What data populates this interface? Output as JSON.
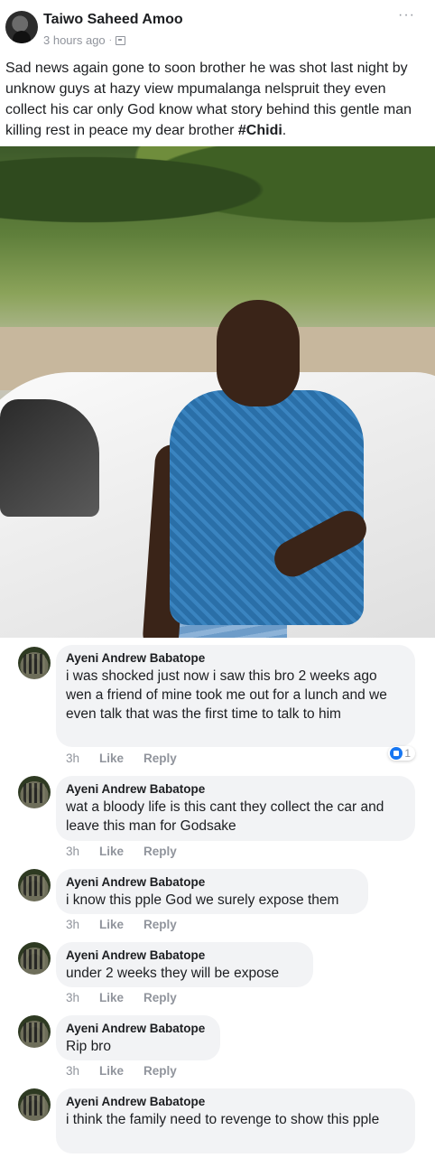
{
  "post": {
    "author": "Taiwo Saheed Amoo",
    "timestamp": "3 hours ago",
    "separator": "·",
    "privacy_icon": "globe-icon",
    "more_icon": "···",
    "text_main": "Sad news again gone to soon brother  he was shot last night by unknow guys at hazy view mpumalanga nelspruit they even collect his car only God know what  story behind this gentle man killing rest in peace my dear brother ",
    "hashtag": "#Chidi",
    "text_end": "."
  },
  "comments": [
    {
      "author": "Ayeni Andrew Babatope",
      "text": "i was shocked just now i saw this bro 2 weeks ago wen a friend of mine took me out for a lunch and we even talk that was the first time to talk to him",
      "time": "3h",
      "like_label": "Like",
      "reply_label": "Reply",
      "reaction_count": "1"
    },
    {
      "author": "Ayeni Andrew Babatope",
      "text": "wat a bloody life is this cant they collect the car and leave this man for Godsake",
      "time": "3h",
      "like_label": "Like",
      "reply_label": "Reply"
    },
    {
      "author": "Ayeni Andrew Babatope",
      "text": "i know this pple God we surely expose them",
      "time": "3h",
      "like_label": "Like",
      "reply_label": "Reply"
    },
    {
      "author": "Ayeni Andrew Babatope",
      "text": "under 2 weeks they will be expose",
      "time": "3h",
      "like_label": "Like",
      "reply_label": "Reply"
    },
    {
      "author": "Ayeni Andrew Babatope",
      "text": "Rip bro",
      "time": "3h",
      "like_label": "Like",
      "reply_label": "Reply"
    },
    {
      "author": "Ayeni Andrew Babatope",
      "text": "i think the family need to revenge to show this pple"
    }
  ],
  "colors": {
    "text": "#1c1e21",
    "meta": "#90949c",
    "bubble": "#f2f3f5",
    "like_blue": "#1877f2"
  }
}
